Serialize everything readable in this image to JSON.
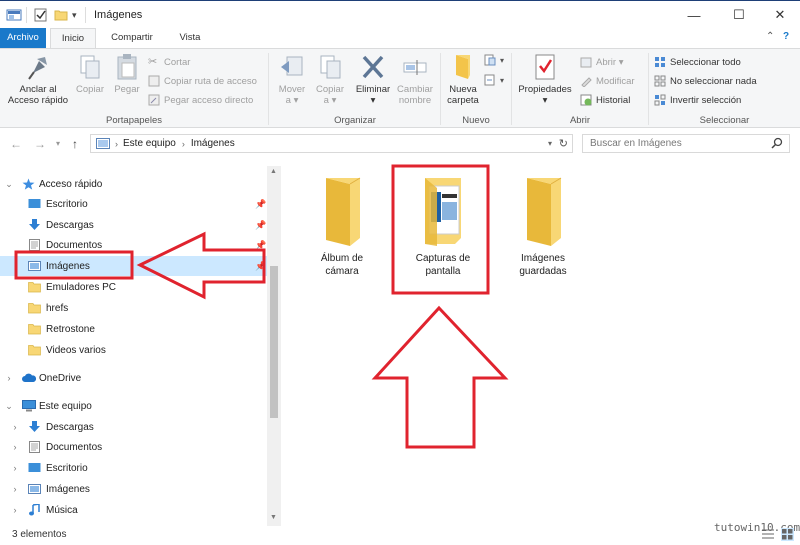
{
  "window": {
    "title": "Imágenes",
    "controls": {
      "minimize": "—",
      "maximize": "☐",
      "close": "✕"
    }
  },
  "ribbon_tabs": [
    {
      "label": "Archivo"
    },
    {
      "label": "Inicio"
    },
    {
      "label": "Compartir"
    },
    {
      "label": "Vista"
    }
  ],
  "ribbon": {
    "portapapeles": {
      "title": "Portapapeles",
      "anclar": "Anclar al\nAcceso rápido",
      "copiar": "Copiar",
      "pegar": "Pegar",
      "cortar": "Cortar",
      "copiar_ruta": "Copiar ruta de acceso",
      "pegar_acceso": "Pegar acceso directo"
    },
    "organizar": {
      "title": "Organizar",
      "mover": "Mover\na ▾",
      "copiar": "Copiar\na ▾",
      "eliminar": "Eliminar\n▾",
      "cambiar": "Cambiar\nnombre"
    },
    "nuevo": {
      "title": "Nuevo",
      "nueva_carpeta": "Nueva\ncarpeta"
    },
    "abrir": {
      "title": "Abrir",
      "propiedades": "Propiedades\n▾",
      "abrir": "Abrir ▾",
      "modificar": "Modificar",
      "historial": "Historial"
    },
    "seleccionar": {
      "title": "Seleccionar",
      "todo": "Seleccionar todo",
      "nada": "No seleccionar nada",
      "invertir": "Invertir selección"
    }
  },
  "address": {
    "path": [
      "Este equipo",
      "Imágenes"
    ],
    "search_placeholder": "Buscar en Imágenes"
  },
  "nav_pane": {
    "quick_access": "Acceso rápido",
    "quick_items": [
      "Escritorio",
      "Descargas",
      "Documentos",
      "Imágenes",
      "Emuladores PC",
      "hrefs",
      "Retrostone",
      "Videos varios"
    ],
    "onedrive": "OneDrive",
    "this_pc": "Este equipo",
    "pc_items": [
      "Descargas",
      "Documentos",
      "Escritorio",
      "Imágenes",
      "Música"
    ]
  },
  "folders": [
    {
      "name": "Álbum de\ncámara"
    },
    {
      "name": "Capturas de\npantalla"
    },
    {
      "name": "Imágenes\nguardadas"
    }
  ],
  "status": {
    "item_count": "3 elementos"
  },
  "watermark": "tutowin10.com",
  "colors": {
    "accent": "#1979ca",
    "highlight": "#cce8ff",
    "annotation": "#e0232e",
    "folder": "#f8d775"
  }
}
